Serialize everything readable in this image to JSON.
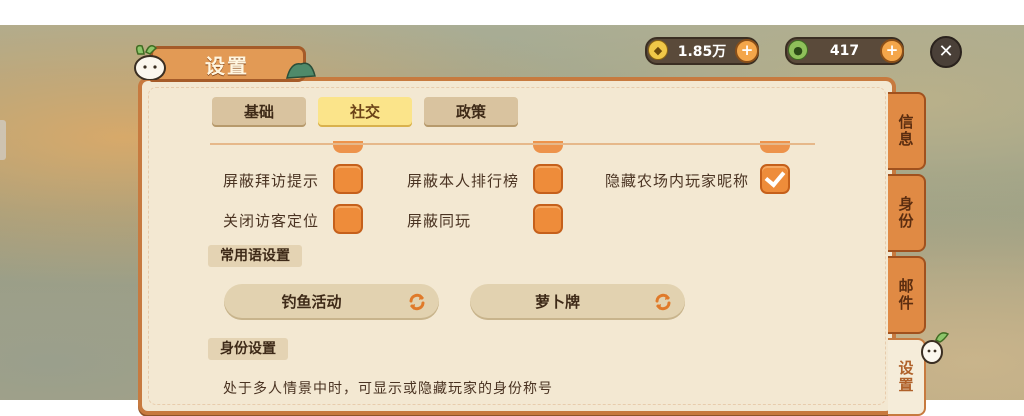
{
  "window": {
    "title": "设置"
  },
  "currencies": [
    {
      "icon": "gold-coin-icon",
      "value": "1.85万"
    },
    {
      "icon": "green-gem-icon",
      "value": "417"
    }
  ],
  "top_tabs": [
    {
      "label": "基础",
      "active": false
    },
    {
      "label": "社交",
      "active": true
    },
    {
      "label": "政策",
      "active": false
    }
  ],
  "options": [
    {
      "label": "屏蔽拜访提示",
      "checked": false
    },
    {
      "label": "屏蔽本人排行榜",
      "checked": false
    },
    {
      "label": "隐藏农场内玩家昵称",
      "checked": true
    },
    {
      "label": "关闭访客定位",
      "checked": false
    },
    {
      "label": "屏蔽同玩",
      "checked": false
    }
  ],
  "phrases_section": {
    "header": "常用语设置",
    "items": [
      {
        "label": "钓鱼活动"
      },
      {
        "label": "萝卜牌"
      }
    ]
  },
  "identity_section": {
    "header": "身份设置",
    "description": "处于多人情景中时，可显示或隐藏玩家的身份称号"
  },
  "side_tabs": [
    {
      "label": "信息",
      "active": false
    },
    {
      "label": "身份",
      "active": false
    },
    {
      "label": "邮件",
      "active": false
    },
    {
      "label": "设置",
      "active": true
    }
  ],
  "colors": {
    "accent": "#ee8c3a",
    "panel": "#f3e8d2",
    "border": "#c77a3f"
  }
}
